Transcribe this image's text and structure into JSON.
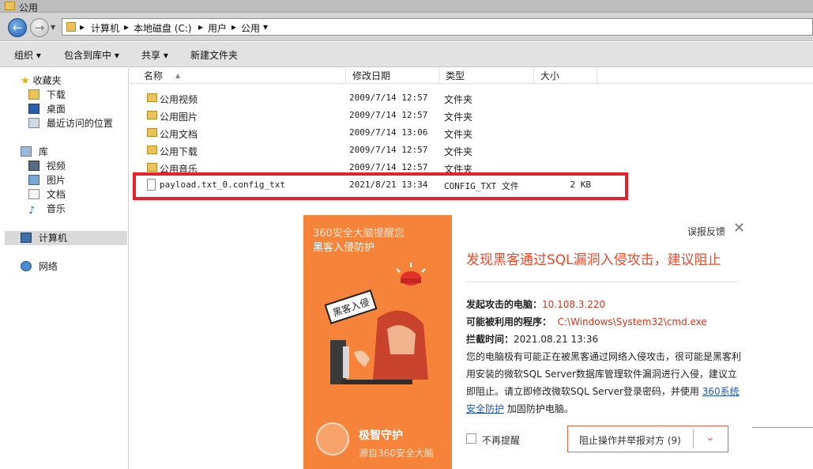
{
  "window": {
    "title": "公用"
  },
  "address": {
    "crumbs": [
      "计算机",
      "本地磁盘 (C:)",
      "用户",
      "公用"
    ],
    "sep": "▸",
    "dropdown": "▾"
  },
  "toolbar": {
    "organize": "组织 ▾",
    "include_library": "包含到库中 ▾",
    "share": "共享 ▾",
    "new_folder": "新建文件夹"
  },
  "nav": {
    "favorites": "收藏夹",
    "downloads": "下载",
    "desktop": "桌面",
    "recent": "最近访问的位置",
    "libraries": "库",
    "videos": "视频",
    "pictures": "图片",
    "documents": "文档",
    "music": "音乐",
    "computer": "计算机",
    "network": "网络"
  },
  "columns": {
    "name": "名称",
    "modified": "修改日期",
    "type": "类型",
    "size": "大小"
  },
  "files": [
    {
      "name": "公用视频",
      "date": "2009/7/14 12:57",
      "type": "文件夹",
      "size": ""
    },
    {
      "name": "公用图片",
      "date": "2009/7/14 12:57",
      "type": "文件夹",
      "size": ""
    },
    {
      "name": "公用文档",
      "date": "2009/7/14 13:06",
      "type": "文件夹",
      "size": ""
    },
    {
      "name": "公用下载",
      "date": "2009/7/14 12:57",
      "type": "文件夹",
      "size": ""
    },
    {
      "name": "公用音乐",
      "date": "2009/7/14 12:57",
      "type": "文件夹",
      "size": ""
    },
    {
      "name": "payload.txt_0.config_txt",
      "date": "2021/8/21 13:34",
      "type": "CONFIG_TXT 文件",
      "size": "2 KB"
    }
  ],
  "popup": {
    "tag_line1": "360安全大脑提醒您",
    "tag_line2": "黑客入侵防护",
    "badge": "黑客入侵",
    "brand_title": "极智守护",
    "brand_sub": "源自360安全大脑",
    "feedback": "误报反馈",
    "close": "✕",
    "headline": "发现黑客通过SQL漏洞入侵攻击，建议阻止",
    "attacker_label": "发起攻击的电脑：",
    "attacker_value": "10.108.3.220",
    "program_label": "可能被利用的程序：",
    "program_value": "C:\\Windows\\System32\\cmd.exe",
    "time_label": "拦截时间：",
    "time_value": "2021.08.21 13:36",
    "para_text": "您的电脑极有可能正在被黑客通过网络入侵攻击，很可能是黑客利用安装的微软SQL Server数据库管理软件漏洞进行入侵，建议立即阻止。请立即修改微软SQL Server登录密码，并使用 ",
    "para_link": "360系统安全防护",
    "para_tail": " 加固防护电脑。",
    "no_remind": "不再提醒",
    "action": "阻止操作并举报对方 (9)",
    "action_chevron": "⌄"
  },
  "colors": {
    "accent_orange": "#f5843a",
    "alert_red": "#e84a2b",
    "highlight_box": "#e8202a"
  }
}
